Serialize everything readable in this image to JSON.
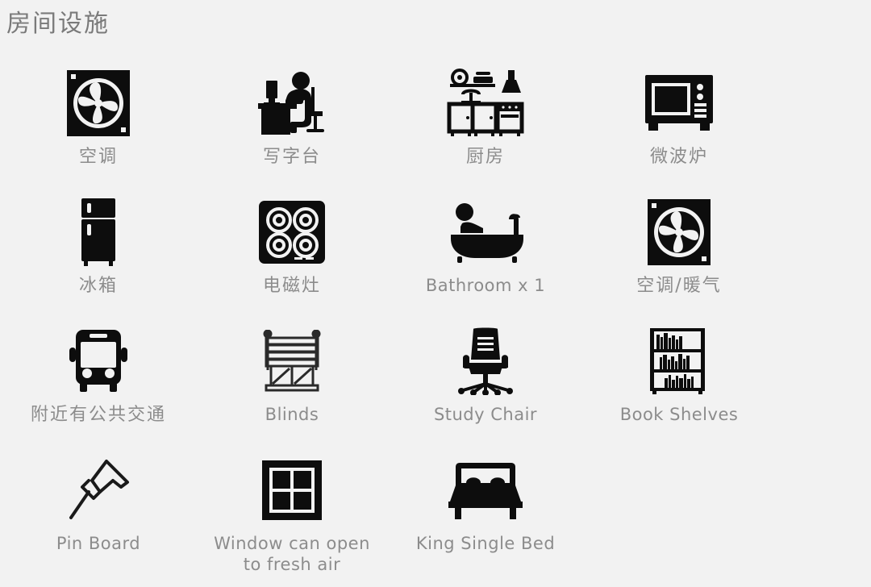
{
  "header": {
    "title": "房间设施"
  },
  "colors": {
    "background": "#f2f2f2",
    "icon": "#0d0d0d",
    "label_text": "#8c8c8c",
    "title_text": "#7a7a7a"
  },
  "amenities": [
    {
      "icon": "air-conditioner-fan-icon",
      "label": "空调",
      "script": "cjk"
    },
    {
      "icon": "desk-with-person-icon",
      "label": "写字台",
      "script": "cjk"
    },
    {
      "icon": "kitchen-cabinets-icon",
      "label": "厨房",
      "script": "cjk"
    },
    {
      "icon": "microwave-icon",
      "label": "微波炉",
      "script": "cjk"
    },
    {
      "icon": "refrigerator-icon",
      "label": "冰箱",
      "script": "cjk"
    },
    {
      "icon": "induction-cooktop-icon",
      "label": "电磁灶",
      "script": "cjk"
    },
    {
      "icon": "bathtub-icon",
      "label": "Bathroom x 1",
      "script": "latin"
    },
    {
      "icon": "air-conditioner-fan-icon",
      "label": "空调/暖气",
      "script": "cjk"
    },
    {
      "icon": "bus-icon",
      "label": "附近有公共交通",
      "script": "cjk"
    },
    {
      "icon": "window-blinds-icon",
      "label": "Blinds",
      "script": "latin"
    },
    {
      "icon": "office-chair-icon",
      "label": "Study Chair",
      "script": "latin"
    },
    {
      "icon": "bookshelf-icon",
      "label": "Book Shelves",
      "script": "latin"
    },
    {
      "icon": "push-pin-icon",
      "label": "Pin Board",
      "script": "latin"
    },
    {
      "icon": "window-four-pane-icon",
      "label": "Window can open\nto fresh air",
      "script": "latin"
    },
    {
      "icon": "bed-icon",
      "label": "King Single Bed",
      "script": "latin"
    }
  ]
}
